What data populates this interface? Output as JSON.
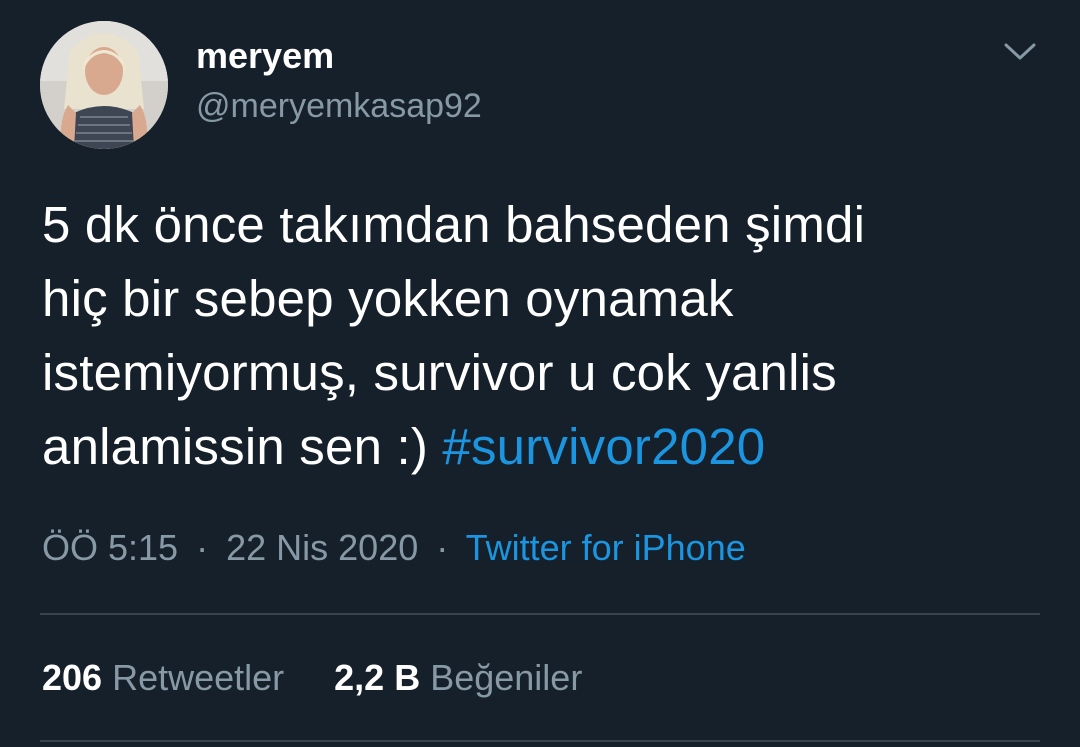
{
  "author": {
    "display_name": "meryem",
    "handle": "@meryemkasap92"
  },
  "tweet": {
    "lines": [
      "5 dk önce takımdan bahseden şimdi",
      "hiç bir sebep yokken oynamak",
      "istemiyormuş, survivor u cok yanlis"
    ],
    "last_line_text": "anlamissin sen :) ",
    "hashtag": "#survivor2020"
  },
  "meta": {
    "time": "ÖÖ 5:15",
    "separator_1": "·",
    "date": "22 Nis 2020",
    "separator_2": "·",
    "source": "Twitter for iPhone"
  },
  "stats": {
    "retweets_count": "206",
    "retweets_label": "Retweetler",
    "likes_count": "2,2 B",
    "likes_label": "Beğeniler"
  },
  "icons": {
    "more": "chevron-down-icon"
  },
  "colors": {
    "background": "#15202b",
    "text_primary": "#ffffff",
    "text_secondary": "#8899a6",
    "accent": "#1b95e0",
    "divider": "#38444d"
  }
}
